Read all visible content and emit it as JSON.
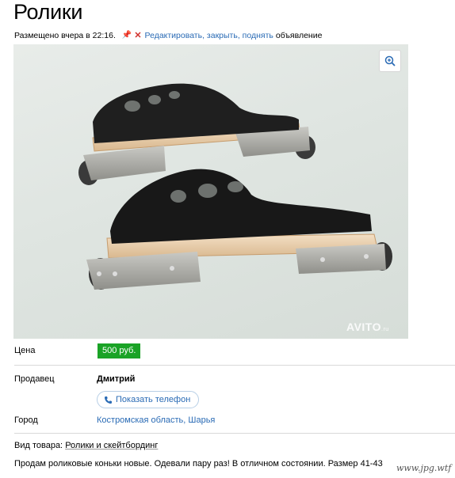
{
  "page": {
    "title": "Ролики",
    "posted": "Размещено вчера в 22:16.",
    "edit_link": "Редактировать, закрыть, поднять",
    "edit_suffix": "объявление"
  },
  "photo": {
    "icon": "zoom-in-icon",
    "watermark": "AVITO",
    "watermark_tld": ".ru"
  },
  "details": {
    "price_label": "Цена",
    "price_value": "500 руб.",
    "seller_label": "Продавец",
    "seller_name": "Дмитрий",
    "phone_button": "Показать телефон",
    "city_label": "Город",
    "city_value": "Костромская область, Шарья"
  },
  "category": {
    "label": "Вид товара:",
    "value": "Ролики и скейтбординг"
  },
  "description": "Продам роликовые коньки новые. Одевали пару раз! В отличном состоянии. Размер 41-43",
  "site_watermark": "www.jpg.wtf",
  "colors": {
    "price_badge": "#1aa326",
    "link": "#2a6bb5",
    "delete": "#d0312d"
  }
}
